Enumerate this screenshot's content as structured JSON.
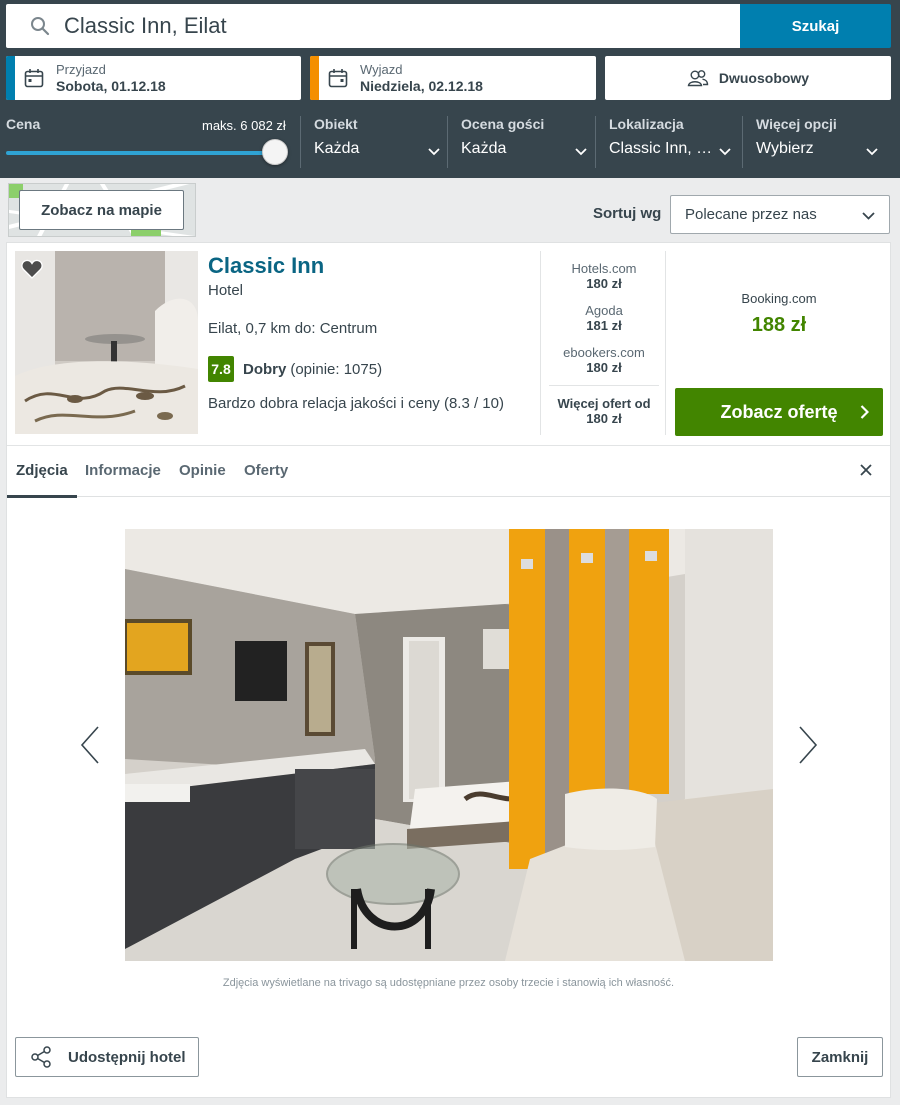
{
  "search": {
    "query": "Classic Inn, Eilat",
    "button_label": "Szukaj",
    "icon": "search-icon"
  },
  "dates": {
    "checkin_label": "Przyjazd",
    "checkin_value": "Sobota, 01.12.18",
    "checkout_label": "Wyjazd",
    "checkout_value": "Niedziela, 02.12.18"
  },
  "guests": {
    "label": "Dwuosobowy",
    "icon": "users-icon"
  },
  "filters": {
    "price_label": "Cena",
    "price_max": "maks. 6 082 zł",
    "price_slider_fraction": 1.0,
    "property_label": "Obiekt",
    "property_value": "Każda",
    "rating_label": "Ocena gości",
    "rating_value": "Każda",
    "location_label": "Lokalizacja",
    "location_value": "Classic Inn, …",
    "more_label": "Więcej opcji",
    "more_value": "Wybierz"
  },
  "toolbar": {
    "map_button": "Zobacz na mapie",
    "sort_label": "Sortuj wg",
    "sort_value": "Polecane przez nas"
  },
  "hotel": {
    "name": "Classic Inn",
    "type": "Hotel",
    "location": "Eilat, 0,7 km do: Centrum",
    "rating_score": "7.8",
    "rating_word": "Dobry",
    "rating_count": "(opinie: 1075)",
    "value_text": "Bardzo dobra relacja jakości i ceny (8.3 / 10)",
    "partners": [
      {
        "name": "Hotels.com",
        "price": "180 zł"
      },
      {
        "name": "Agoda",
        "price": "181 zł"
      },
      {
        "name": "ebookers.com",
        "price": "180 zł"
      }
    ],
    "more_offers_label": "Więcej ofert od",
    "more_offers_price": "180 zł",
    "best_site": "Booking.com",
    "best_price": "188 zł",
    "deal_button": "Zobacz ofertę"
  },
  "tabs": [
    {
      "label": "Zdjęcia",
      "active": true
    },
    {
      "label": "Informacje",
      "active": false
    },
    {
      "label": "Opinie",
      "active": false
    },
    {
      "label": "Oferty",
      "active": false
    }
  ],
  "gallery": {
    "disclaimer": "Zdjęcia wyświetlane na trivago są udostępniane przez osoby trzecie i stanowią ich własność."
  },
  "footer": {
    "share_button": "Udostępnij hotel",
    "close_button": "Zamknij"
  },
  "colors": {
    "header_bg": "#37454d",
    "search_button": "#007faf",
    "checkin_accent": "#007faf",
    "checkout_accent": "#f48f00",
    "rating_green": "#428500",
    "deal_green": "#428500",
    "hotel_name": "#0a6583"
  }
}
